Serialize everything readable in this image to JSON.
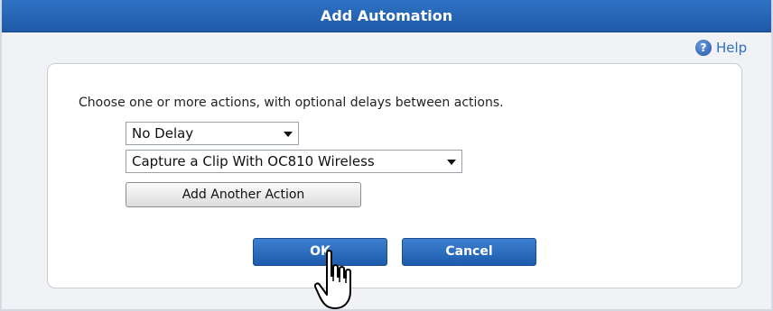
{
  "dialog": {
    "title": "Add Automation",
    "help_label": "Help",
    "instruction": "Choose one or more actions, with optional delays between actions.",
    "delay_select": {
      "selected": "No Delay"
    },
    "action_select": {
      "selected": "Capture a Clip With OC810 Wireless"
    },
    "add_action_label": "Add Another Action",
    "ok_label": "OK",
    "cancel_label": "Cancel"
  },
  "icons": {
    "help": "help-question-icon",
    "dropdown": "chevron-down-icon",
    "cursor": "hand-pointer-cursor-icon"
  },
  "colors": {
    "titlebar": "#1f5aa8",
    "button_primary": "#2b6cc0",
    "help_text": "#2f6fc4",
    "panel_bg": "#ffffff",
    "dialog_bg": "#f0f2f5"
  }
}
